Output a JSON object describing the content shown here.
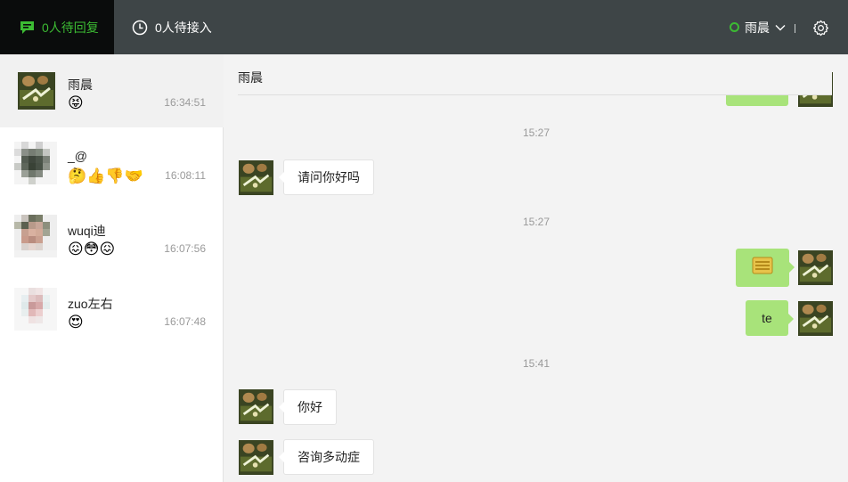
{
  "topbar": {
    "tab_reply": "0人待回复",
    "tab_access": "0人待接入",
    "user_name": "雨晨",
    "accent": "#3cbb33"
  },
  "conversations": [
    {
      "name": "雨晨",
      "preview": "😝",
      "time": "16:34:51"
    },
    {
      "name": "_@",
      "preview": "🤔👍👎🤝",
      "time": "16:08:11"
    },
    {
      "name": "wuqi迪",
      "preview": "😖😳😖",
      "time": "16:07:56"
    },
    {
      "name": "zuo左右",
      "preview": "😍",
      "time": "16:07:48"
    }
  ],
  "chat": {
    "title": "雨晨",
    "stamp1": "15:27",
    "msg1": "请问你好吗",
    "stamp2": "15:27",
    "out_emoji": "icon-emoji",
    "out_text": "te",
    "stamp3": "15:41",
    "msg3": "你好",
    "msg4": "咨询多动症"
  }
}
